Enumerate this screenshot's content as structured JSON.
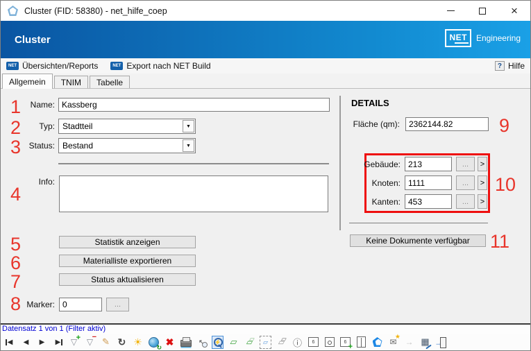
{
  "window": {
    "title": "Cluster (FID: 58380) - net_hilfe_coep",
    "controls": [
      "minimize",
      "maximize",
      "close"
    ],
    "close_glyph": "×"
  },
  "header": {
    "app_title": "Cluster",
    "brand": {
      "logo_text": "NET",
      "brand_text": "Engineering"
    }
  },
  "menubar": {
    "net_chip": "NET",
    "items": [
      {
        "label": "Übersichten/Reports"
      },
      {
        "label": "Export nach NET Build"
      }
    ],
    "help": {
      "icon": "?",
      "label": "Hilfe"
    }
  },
  "tabs": [
    {
      "label": "Allgemein",
      "active": true
    },
    {
      "label": "TNIM",
      "active": false
    },
    {
      "label": "Tabelle",
      "active": false
    }
  ],
  "form": {
    "name": {
      "label": "Name:",
      "value": "Kassberg"
    },
    "typ": {
      "label": "Typ:",
      "value": "Stadtteil",
      "dropdown_glyph": "▼"
    },
    "status": {
      "label": "Status:",
      "value": "Bestand",
      "dropdown_glyph": "▼"
    },
    "info": {
      "label": "Info:",
      "value": ""
    },
    "buttons": {
      "statistik": "Statistik anzeigen",
      "materialliste": "Materialliste exportieren",
      "status_aktualisieren": "Status aktualisieren"
    },
    "marker": {
      "label": "Marker:",
      "value": "0",
      "browse": "..."
    }
  },
  "details": {
    "heading": "DETAILS",
    "flaeche": {
      "label": "Fläche (qm):",
      "value": "2362144.82"
    },
    "counts": [
      {
        "label": "Gebäude:",
        "value": "213",
        "browse": "...",
        "open": ">"
      },
      {
        "label": "Knoten:",
        "value": "1111",
        "browse": "...",
        "open": ">"
      },
      {
        "label": "Kanten:",
        "value": "453",
        "browse": "...",
        "open": ">"
      }
    ],
    "documents_button": "Keine Dokumente verfügbar"
  },
  "annotations": {
    "color": "#e8352b",
    "numbers": [
      "1",
      "2",
      "3",
      "4",
      "5",
      "6",
      "7",
      "8",
      "9",
      "10",
      "11"
    ]
  },
  "statusbar": {
    "text": "Datensatz 1 von 1 (Filter aktiv)"
  },
  "bottom_toolbar": {
    "icons": [
      {
        "name": "nav-first-icon",
        "glyph": "◀"
      },
      {
        "name": "nav-previous-icon",
        "glyph": "◀"
      },
      {
        "name": "nav-next-icon",
        "glyph": "▶"
      },
      {
        "name": "nav-last-icon",
        "glyph": "▶"
      },
      {
        "name": "filter-add-icon",
        "glyph": "▽"
      },
      {
        "name": "filter-remove-icon",
        "glyph": "▽"
      },
      {
        "name": "edit-pencil-icon",
        "glyph": "✎"
      },
      {
        "name": "refresh-icon",
        "glyph": "↻"
      },
      {
        "name": "sun-icon",
        "glyph": "☀"
      },
      {
        "name": "globe-refresh-icon",
        "glyph": ""
      },
      {
        "name": "delete-x-icon",
        "glyph": "✖"
      },
      {
        "name": "print-icon",
        "glyph": ""
      },
      {
        "name": "select-zoom-icon",
        "glyph": "↖"
      },
      {
        "name": "zoom-flash-icon",
        "glyph": "⚡",
        "active": true
      },
      {
        "name": "cube-icon",
        "glyph": "▱"
      },
      {
        "name": "cubes-icon",
        "glyph": "▱"
      },
      {
        "name": "selection-cube-icon",
        "glyph": "▱"
      },
      {
        "name": "group-cubes-icon",
        "glyph": "▱"
      },
      {
        "name": "info-icon",
        "glyph": "ⓘ"
      },
      {
        "name": "photos-icon",
        "glyph": ""
      },
      {
        "name": "photo-icon",
        "glyph": ""
      },
      {
        "name": "photo-add-icon",
        "glyph": ""
      },
      {
        "name": "split-document-icon",
        "glyph": ""
      },
      {
        "name": "pentagon-icon",
        "glyph": ""
      },
      {
        "name": "message-star-icon",
        "glyph": "✉"
      },
      {
        "name": "transfer-disabled-icon",
        "glyph": "→"
      },
      {
        "name": "table-edit-icon",
        "glyph": "▦"
      },
      {
        "name": "exit-icon",
        "glyph": ""
      }
    ]
  },
  "colors": {
    "header_gradient_start": "#0a55a2",
    "header_gradient_end": "#1aa0e6",
    "net_brand_blue": "#1460aa",
    "annotation_red": "#e8352b",
    "group_box_red": "#ee0f0f",
    "status_text_blue": "#0000d4"
  }
}
